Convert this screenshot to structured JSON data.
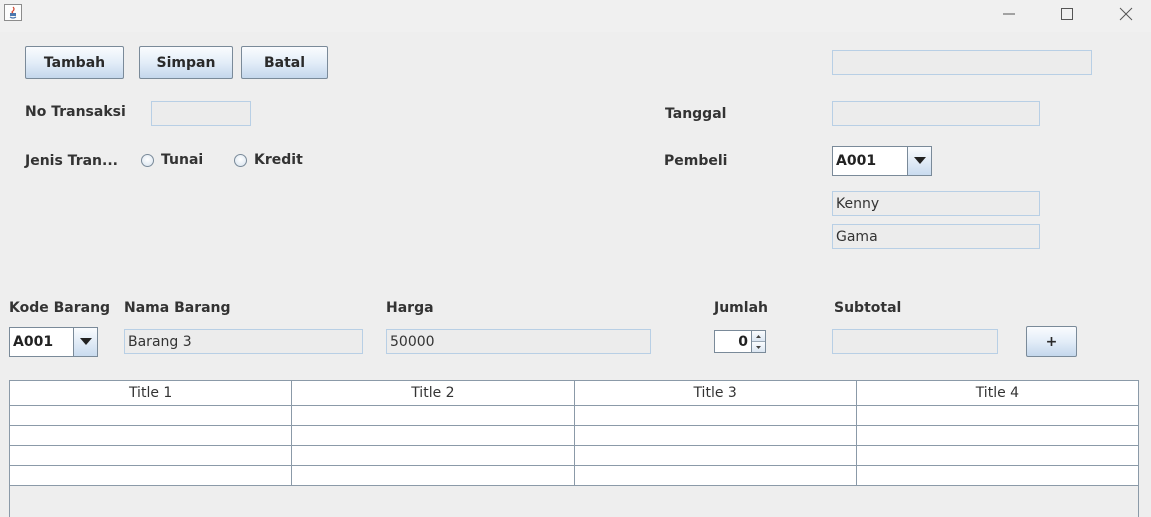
{
  "toolbar": {
    "tambah": "Tambah",
    "simpan": "Simpan",
    "batal": "Batal"
  },
  "top_field": {
    "value": ""
  },
  "no_transaksi": {
    "label": "No Transaksi",
    "value": ""
  },
  "jenis": {
    "label": "Jenis Tran...",
    "options": [
      "Tunai",
      "Kredit"
    ]
  },
  "tanggal": {
    "label": "Tanggal",
    "value": ""
  },
  "pembeli": {
    "label": "Pembeli",
    "selected": "A001",
    "nama": "Kenny",
    "alamat": "Gama"
  },
  "item": {
    "kode_label": "Kode Barang",
    "kode_selected": "A001",
    "nama_label": "Nama Barang",
    "nama_value": "Barang 3",
    "harga_label": "Harga",
    "harga_value": "50000",
    "jumlah_label": "Jumlah",
    "jumlah_value": "0",
    "subtotal_label": "Subtotal",
    "subtotal_value": "",
    "add_label": "+"
  },
  "table": {
    "columns": [
      "Title 1",
      "Title 2",
      "Title 3",
      "Title 4"
    ],
    "rows": [
      [
        "",
        "",
        "",
        ""
      ],
      [
        "",
        "",
        "",
        ""
      ],
      [
        "",
        "",
        "",
        ""
      ],
      [
        "",
        "",
        "",
        ""
      ]
    ]
  },
  "colors": {
    "border": "#7a8a99",
    "field_border": "#b8cfe5",
    "background": "#eeeeee"
  },
  "icons": {
    "app": "java-icon",
    "minimize": "minimize-icon",
    "maximize": "maximize-icon",
    "close": "close-icon",
    "dropdown": "chevron-down-icon"
  }
}
